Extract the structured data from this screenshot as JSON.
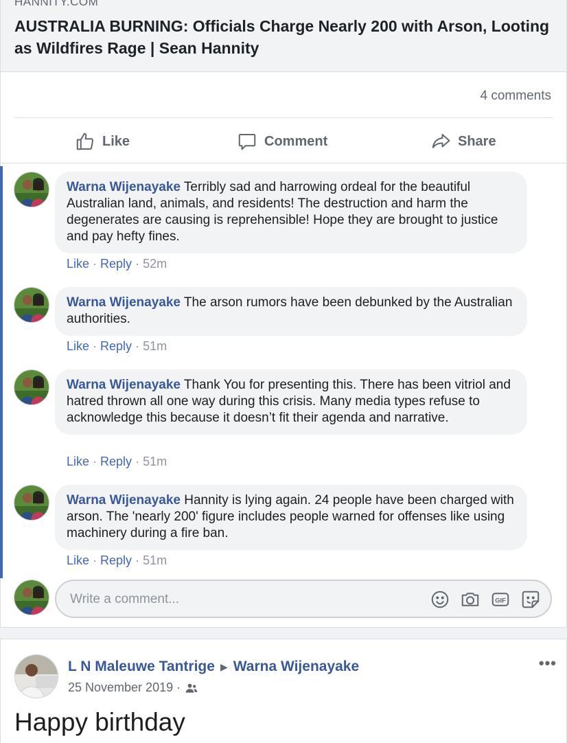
{
  "link_preview": {
    "domain": "HANNITY.COM",
    "title": "AUSTRALIA BURNING: Officials Charge Nearly 200 with Arson, Looting as Wildfires Rage | Sean Hannity"
  },
  "post": {
    "comments_count": "4 comments",
    "actions": {
      "like": "Like",
      "comment": "Comment",
      "share": "Share"
    }
  },
  "comments": [
    {
      "author": "Warna Wijenayake",
      "text": "Terribly sad and harrowing ordeal for the beautiful Australian land, animals, and residents! The destruction and harm the degenerates are causing is reprehensible! Hope they are brought to justice and pay hefty fines.",
      "like": "Like",
      "reply": "Reply",
      "time": "52m"
    },
    {
      "author": "Warna Wijenayake",
      "text": "The arson rumors have been debunked by the Australian authorities.",
      "like": "Like",
      "reply": "Reply",
      "time": "51m"
    },
    {
      "author": "Warna Wijenayake",
      "text": "Thank You for presenting this. There has been vitriol and hatred thrown all one way during this crisis. Many media types refuse to acknowledge this because it doesn’t fit their agenda and narrative.",
      "like": "Like",
      "reply": "Reply",
      "time": "51m"
    },
    {
      "author": "Warna Wijenayake",
      "text": "Hannity is lying again. 24 people have been charged with arson. The 'nearly 200' figure includes people warned for offenses like using machinery during a fire ban.",
      "like": "Like",
      "reply": "Reply",
      "time": "51m"
    }
  ],
  "write_comment": {
    "placeholder": "Write a comment...",
    "icons": [
      "emoji-icon",
      "camera-icon",
      "gif-icon",
      "sticker-icon"
    ],
    "gif_label": "GIF"
  },
  "post2": {
    "author": "L N Maleuwe Tantrige",
    "target": "Warna Wijenayake",
    "date": "25 November 2019 ·",
    "more": "•••",
    "text": "Happy birthday"
  },
  "colors": {
    "link_blue": "#385898",
    "accent_bar": "#4267b2",
    "bubble_bg": "#f2f3f5",
    "muted": "#606770"
  }
}
